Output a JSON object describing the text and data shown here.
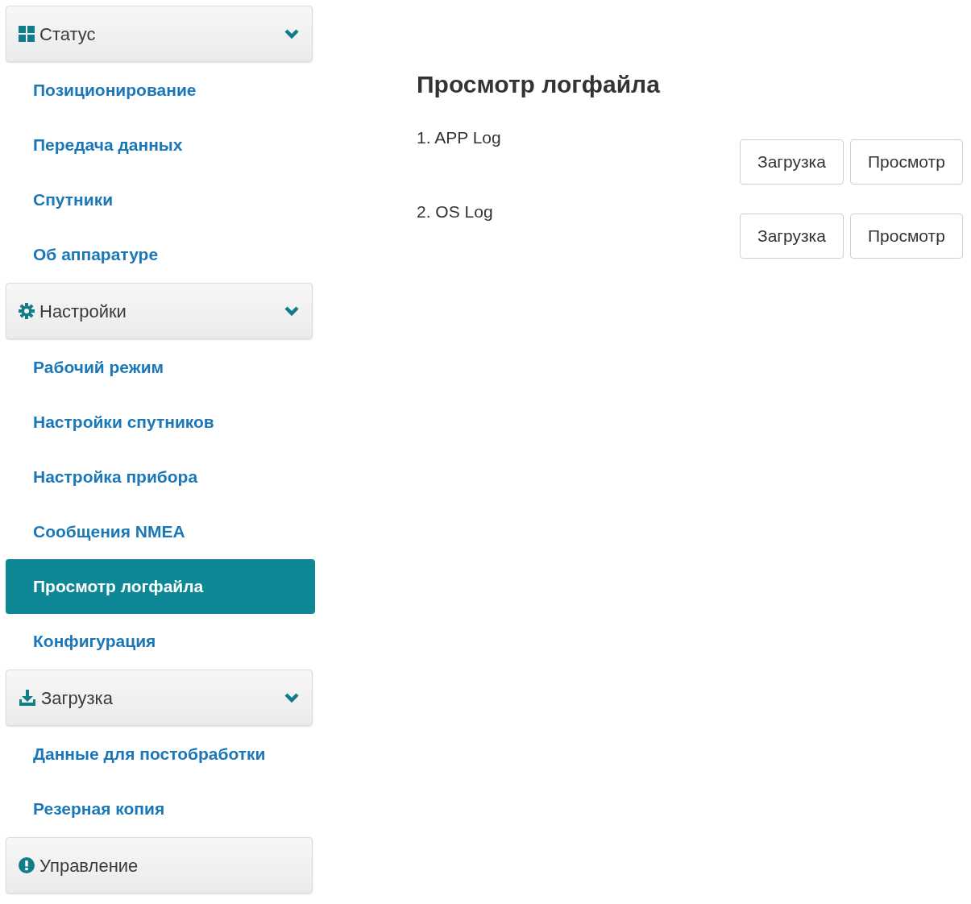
{
  "sidebar": {
    "sections": [
      {
        "title": "Статус",
        "expanded": true,
        "items": [
          {
            "label": "Позиционирование",
            "selected": false
          },
          {
            "label": "Передача данных",
            "selected": false
          },
          {
            "label": "Спутники",
            "selected": false
          },
          {
            "label": "Об аппаратуре",
            "selected": false
          }
        ]
      },
      {
        "title": "Настройки",
        "expanded": true,
        "items": [
          {
            "label": "Рабочий режим",
            "selected": false
          },
          {
            "label": "Настройки спутников",
            "selected": false
          },
          {
            "label": "Настройка прибора",
            "selected": false
          },
          {
            "label": "Сообщения NMEA",
            "selected": false
          },
          {
            "label": "Просмотр логфайла",
            "selected": true
          },
          {
            "label": "Конфигурация",
            "selected": false
          }
        ]
      },
      {
        "title": "Загрузка",
        "expanded": true,
        "items": [
          {
            "label": "Данные для постобработки",
            "selected": false
          },
          {
            "label": "Резерная копия",
            "selected": false
          }
        ]
      },
      {
        "title": "Управление",
        "expanded": false
      }
    ]
  },
  "main": {
    "heading": "Просмотр логфайла",
    "logs": [
      {
        "label": "1. APP Log",
        "buttons": [
          "Загрузка",
          "Просмотр"
        ]
      },
      {
        "label": "2. OS Log",
        "buttons": [
          "Загрузка",
          "Просмотр"
        ]
      }
    ]
  }
}
